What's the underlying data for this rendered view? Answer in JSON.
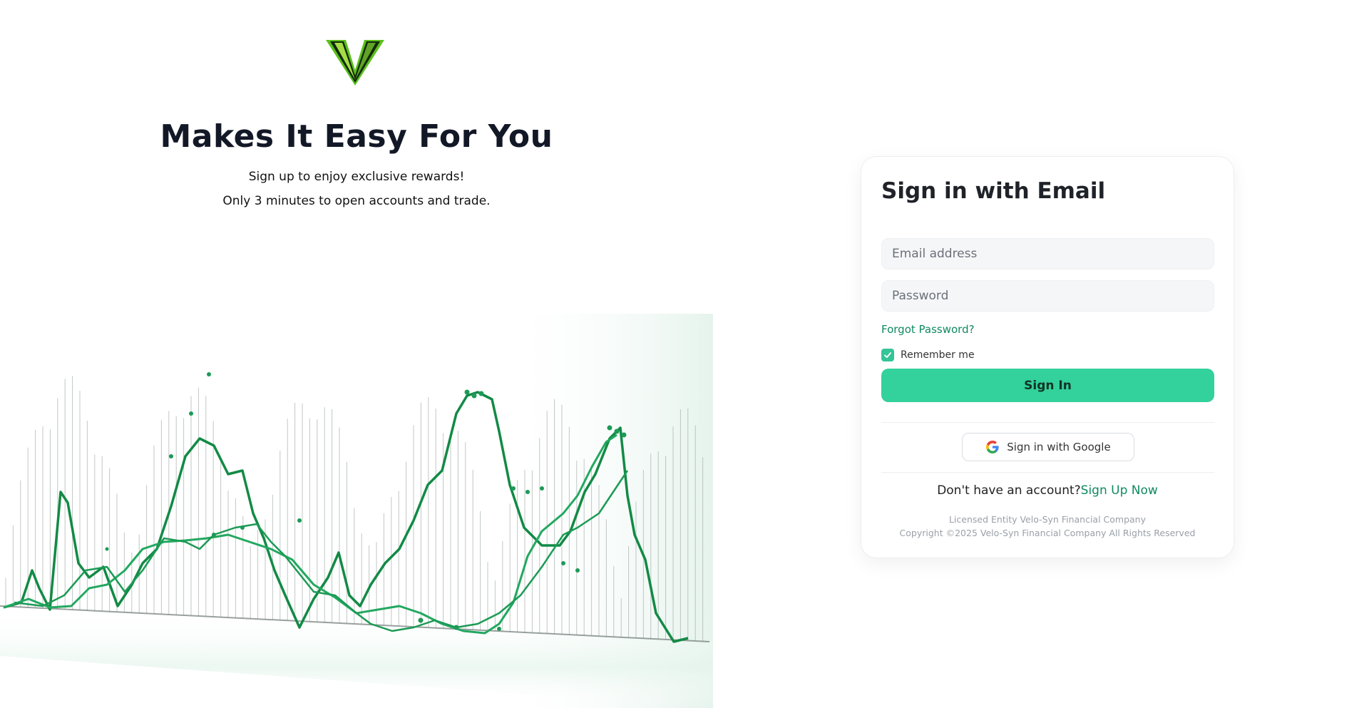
{
  "hero": {
    "title": "Makes It Easy For You",
    "subtitle_1": "Sign up to enjoy exclusive rewards!",
    "subtitle_2": "Only 3 minutes to open accounts and trade.",
    "logo_icon": "velo-syn-v-logo",
    "illustration": "green-market-line-chart-illustration"
  },
  "login": {
    "title": "Sign in with Email",
    "email_placeholder": "Email address",
    "password_placeholder": "Password",
    "forgot_password": "Forgot Password?",
    "remember_me": "Remember me",
    "remember_checked": true,
    "sign_in": "Sign In",
    "google_sign_in": "Sign in with Google",
    "no_account": "Don't have an account?",
    "sign_up": "Sign Up Now",
    "footer_license": "Licensed Entity Velo-Syn Financial Company",
    "footer_copyright": "Copyright ©2025 Velo-Syn Financial Company All Rights Reserved"
  },
  "colors": {
    "accent": "#33d19b",
    "link": "#0f8a5f",
    "title": "#121826"
  }
}
